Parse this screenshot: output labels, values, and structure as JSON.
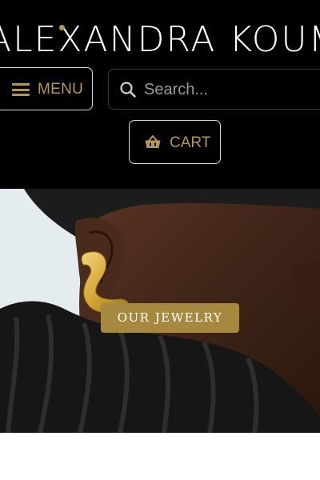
{
  "brand": {
    "logo_text": "ALEXANDRA KOUMBA",
    "accent": "#b49a4c"
  },
  "header": {
    "menu_label": "MENU",
    "menu_icon": "hamburger-icon",
    "search": {
      "placeholder": "Search...",
      "value": "",
      "icon": "search-icon"
    },
    "cart_label": "CART",
    "cart_icon": "basket-icon"
  },
  "hero": {
    "image": "woman wearing gold earring",
    "cta_label": "OUR JEWELRY",
    "cta_color": "#a6893e"
  }
}
